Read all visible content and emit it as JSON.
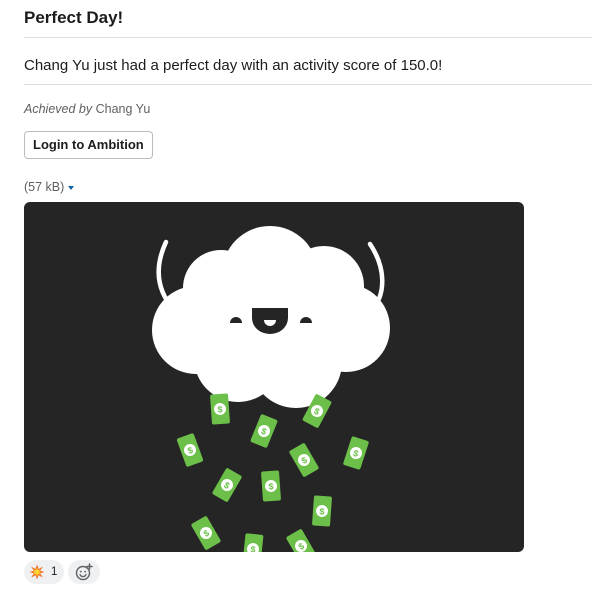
{
  "card": {
    "title": "Perfect Day!",
    "message": "Chang Yu just had a perfect day with an activity score of 150.0!",
    "achieved_prefix": "Achieved by",
    "achieved_name": "Chang Yu",
    "login_button": "Login to Ambition"
  },
  "attachment": {
    "file_size": "(57 kB)",
    "image_icon": "money-raining-cloud"
  },
  "reactions": [
    {
      "emoji": "collision-emoji",
      "count": "1"
    }
  ],
  "add_reaction_icon": "add-reaction-icon",
  "colors": {
    "image_background": "#252525",
    "money_green": "#6cc04a",
    "link_blue": "#1264a3"
  }
}
